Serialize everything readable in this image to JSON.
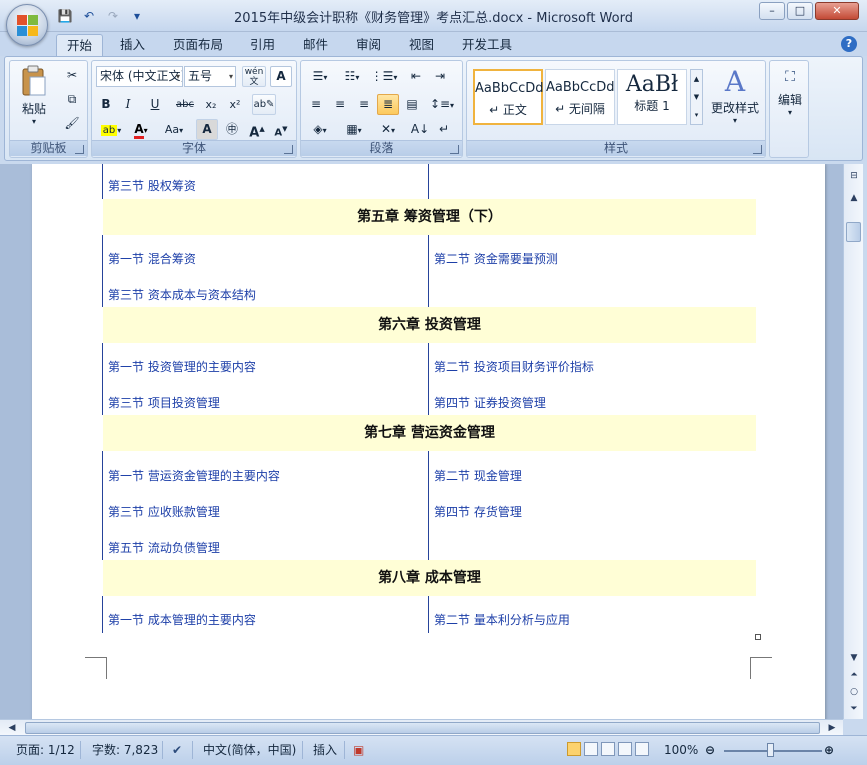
{
  "window": {
    "title": "2015年中级会计职称《财务管理》考点汇总.docx - Microsoft Word"
  },
  "qat": {
    "save": "💾",
    "undo": "↶",
    "redo": "↷",
    "more": "▾"
  },
  "controls": {
    "minimize": "–",
    "maximize": "□",
    "close": "✕"
  },
  "tabs": [
    "开始",
    "插入",
    "页面布局",
    "引用",
    "邮件",
    "审阅",
    "视图",
    "开发工具"
  ],
  "active_tab": "开始",
  "ribbon": {
    "clipboard": {
      "label": "剪贴板",
      "paste": "粘贴"
    },
    "font": {
      "label": "字体",
      "family": "宋体 (中文正文)",
      "size": "五号",
      "bold": "B",
      "italic": "I",
      "underline": "U",
      "strike": "abc",
      "subscript": "x₂",
      "superscript": "x²",
      "grow": "A",
      "shrink": "A",
      "case": "Aa",
      "phonetic": "wén 文",
      "border_char": "A"
    },
    "paragraph": {
      "label": "段落"
    },
    "styles": {
      "label": "样式",
      "items": [
        {
          "preview": "AaBbCcDd",
          "caption": "↵ 正文"
        },
        {
          "preview": "AaBbCcDd",
          "caption": "↵ 无间隔"
        },
        {
          "preview": "AaBł",
          "caption": "标题 1"
        }
      ],
      "change": "更改样式"
    },
    "edit": {
      "label": "编辑"
    }
  },
  "document": {
    "top_row": {
      "left": "第三节  股权筹资"
    },
    "chapters": [
      {
        "title": "第五章  筹资管理（下）",
        "rows": [
          {
            "left": "第一节  混合筹资",
            "right": "第二节  资金需要量预测"
          },
          {
            "left": "第三节  资本成本与资本结构",
            "right": ""
          }
        ]
      },
      {
        "title": "第六章  投资管理",
        "rows": [
          {
            "left": "第一节  投资管理的主要内容",
            "right": "第二节  投资项目财务评价指标"
          },
          {
            "left": "第三节  项目投资管理",
            "right": "第四节  证券投资管理"
          }
        ]
      },
      {
        "title": "第七章  营运资金管理",
        "rows": [
          {
            "left": "第一节  营运资金管理的主要内容",
            "right": "第二节  现金管理"
          },
          {
            "left": "第三节  应收账款管理",
            "right": "第四节  存货管理"
          },
          {
            "left": "第五节  流动负债管理",
            "right": ""
          }
        ]
      },
      {
        "title": "第八章  成本管理",
        "rows": [
          {
            "left": "第一节  成本管理的主要内容",
            "right": "第二节  量本利分析与应用"
          }
        ]
      }
    ]
  },
  "status": {
    "page": "页面: 1/12",
    "words": "字数: 7,823",
    "language": "中文(简体，中国)",
    "mode": "插入",
    "zoom": "100%"
  }
}
